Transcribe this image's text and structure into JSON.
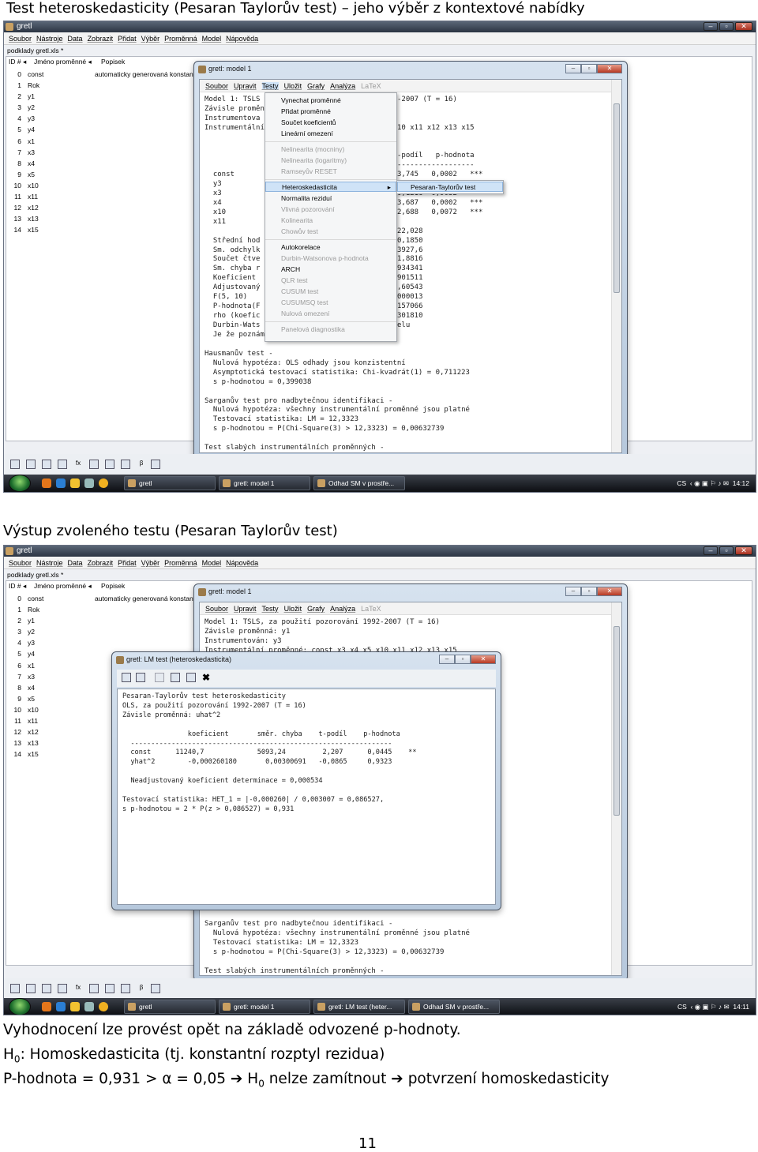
{
  "heading1": "Test heteroskedasticity (Pesaran Taylorův test) – jeho výběr z kontextové nabídky",
  "heading2": "Výstup zvoleného testu (Pesaran Taylorův test)",
  "gretl": {
    "title": "gretl",
    "menu": [
      "Soubor",
      "Nástroje",
      "Data",
      "Zobrazit",
      "Přidat",
      "Výběr",
      "Proměnná",
      "Model",
      "Nápověda"
    ],
    "filename": "podklady gretl.xls *",
    "col_id": "ID # ◂",
    "col_name": "Jméno proměnné ◂",
    "col_desc": "Popisek",
    "vars": [
      {
        "id": "0",
        "name": "const",
        "desc": "automaticky generovaná konstanta"
      },
      {
        "id": "1",
        "name": "Rok",
        "desc": ""
      },
      {
        "id": "2",
        "name": "y1",
        "desc": ""
      },
      {
        "id": "3",
        "name": "y2",
        "desc": ""
      },
      {
        "id": "4",
        "name": "y3",
        "desc": ""
      },
      {
        "id": "5",
        "name": "y4",
        "desc": ""
      },
      {
        "id": "6",
        "name": "x1",
        "desc": ""
      },
      {
        "id": "7",
        "name": "x3",
        "desc": ""
      },
      {
        "id": "8",
        "name": "x4",
        "desc": ""
      },
      {
        "id": "9",
        "name": "x5",
        "desc": ""
      },
      {
        "id": "10",
        "name": "x10",
        "desc": ""
      },
      {
        "id": "11",
        "name": "x11",
        "desc": ""
      },
      {
        "id": "12",
        "name": "x12",
        "desc": ""
      },
      {
        "id": "13",
        "name": "x13",
        "desc": ""
      },
      {
        "id": "14",
        "name": "x15",
        "desc": ""
      }
    ]
  },
  "model_window": {
    "title": "gretl: model 1",
    "menu": [
      "Soubor",
      "Upravit",
      "Testy",
      "Uložit",
      "Grafy",
      "Analýza"
    ],
    "menu_disabled": "LaTeX",
    "text1_left": "Model 1: TSLS\nZávisle proměn\nInstrumentova\nInstrumentální\n\n\n\n\n  const\n  y3\n  x3\n  x4\n  x10\n  x11\n\n  Střední hod\n  Sm. odchylk\n  Součet čtve\n  Sm. chyba r\n  Koeficient\n  Adjustovaný\n  F(5, 10)\n  P-hodnota(F\n  rho (koefic\n  Durbin-Wats\n  Je že poznám",
    "text1_right": "-2007 (T = 16)\n\n\n10 x11 x12 x13 x15\n\n\n-podíl   p-hodnota\n------------------\n3,745   0,0002   ***\n-0,8063 0,4389\n0,1216  0,9032\n3,687   0,0002   ***\n2,688   0,0072   ***\n\n22,028\n0,1850\n3927,6\n1,8816\n934341\n901511\n,60543\n000013\n157066\n301810\nelu",
    "text_bottom": "Hausmanův test -\n  Nulová hypotéza: OLS odhady jsou konzistentní\n  Asymptotická testovací statistika: Chi-kvadrát(1) = 0,711223\n  s p-hodnotou = 0,399038\n\nSarganův test pro nadbytečnou identifikaci -\n  Nulová hypotéza: všechny instrumentální proměnné jsou platné\n  Testovací statistika: LM = 12,3323\n  s p-hodnotou = P(Chi-Square(3) > 12,3323) = 0,00632739\n\nTest slabých instrumentálních proměnných -",
    "text2_top": "Model 1: TSLS, za použití pozorování 1992-2007 (T = 16)\nZávisle proměnná: y1\nInstrumentován: y3\nInstrumentální proměnné: const x3 x4 x5 x10 x11 x12 x13 x15",
    "text2_bottom": "Sarganův test pro nadbytečnou identifikaci -\n  Nulová hypotéza: všechny instrumentální proměnné jsou platné\n  Testovací statistika: LM = 12,3323\n  s p-hodnotou = P(Chi-Square(3) > 12,3323) = 0,00632739\n\nTest slabých instrumentálních proměnných -"
  },
  "context_menu": {
    "items": [
      {
        "label": "Vynechat proměnné",
        "state": "on"
      },
      {
        "label": "Přidat proměnné",
        "state": "on"
      },
      {
        "label": "Součet koeficientů",
        "state": "on"
      },
      {
        "label": "Lineární omezení",
        "state": "on"
      },
      {
        "label": "Nelinearita (mocniny)",
        "state": "off"
      },
      {
        "label": "Nelinearita (logaritmy)",
        "state": "off"
      },
      {
        "label": "Ramseyův RESET",
        "state": "off"
      },
      {
        "label": "Heteroskedasticita",
        "state": "hl"
      },
      {
        "label": "Normalita reziduí",
        "state": "on"
      },
      {
        "label": "Vlivná pozorování",
        "state": "off"
      },
      {
        "label": "Kolinearita",
        "state": "off"
      },
      {
        "label": "Chowův test",
        "state": "off"
      },
      {
        "label": "Autokorelace",
        "state": "on"
      },
      {
        "label": "Durbin-Watsonova p-hodnota",
        "state": "off"
      },
      {
        "label": "ARCH",
        "state": "on"
      },
      {
        "label": "QLR test",
        "state": "off"
      },
      {
        "label": "CUSUM test",
        "state": "off"
      },
      {
        "label": "CUSUMSQ test",
        "state": "off"
      },
      {
        "label": "Nulová omezení",
        "state": "off"
      },
      {
        "label": "Panelová diagnostika",
        "state": "off"
      }
    ],
    "submenu": "Pesaran-Taylorův test"
  },
  "lm_window": {
    "title": "gretl: LM test (heteroskedasticita)",
    "text": "Pesaran-Taylorův test heteroskedasticity\nOLS, za použití pozorování 1992-2007 (T = 16)\nZávisle proměnná: uhat^2\n\n                koeficient       směr. chyba    t-podíl    p-hodnota\n  ----------------------------------------------------------------\n  const      11240,7             5093,24         2,207      0,0445    **\n  yhat^2        -0,000260180       0,00300691   -0,0865     0,9323\n\n  Neadjustovaný koeficient determinace = 0,000534\n\nTestovací statistika: HET_1 = |-0,000260| / 0,003007 = 0,086527,\ns p-hodnotou = 2 * P(z > 0,086527) = 0,931"
  },
  "taskbar1": {
    "start": "",
    "buttons": [
      "gretl",
      "gretl: model 1",
      "Odhad SM v prostře..."
    ],
    "lang": "CS",
    "time": "14:12"
  },
  "taskbar2": {
    "buttons": [
      "gretl",
      "gretl: model 1",
      "gretl: LM test (heter...",
      "Odhad SM v prostře..."
    ],
    "lang": "CS",
    "time": "14:11"
  },
  "icons": [
    "start-orb",
    "firefox-icon",
    "ie-icon",
    "explorer-icon"
  ],
  "conclusion": {
    "line1": "Vyhodnocení lze provést opět na základě odvozené p-hodnoty.",
    "line2_h": "H",
    "line2_sub": "0",
    "line2_rest": ": Homoskedasticita (tj. konstantní rozptyl rezidua)",
    "line3_a": "P-hodnota = 0,931 > α = 0,05 ",
    "arrow": "➔",
    "line3_h": " H",
    "line3_sub": "0",
    "line3_b": " nelze zamítnout ",
    "line3_c": " potvrzení homoskedasticity"
  },
  "page_number": "11",
  "colors": {
    "accent": "#cfe3f7",
    "titlebar": "#2b3442"
  }
}
